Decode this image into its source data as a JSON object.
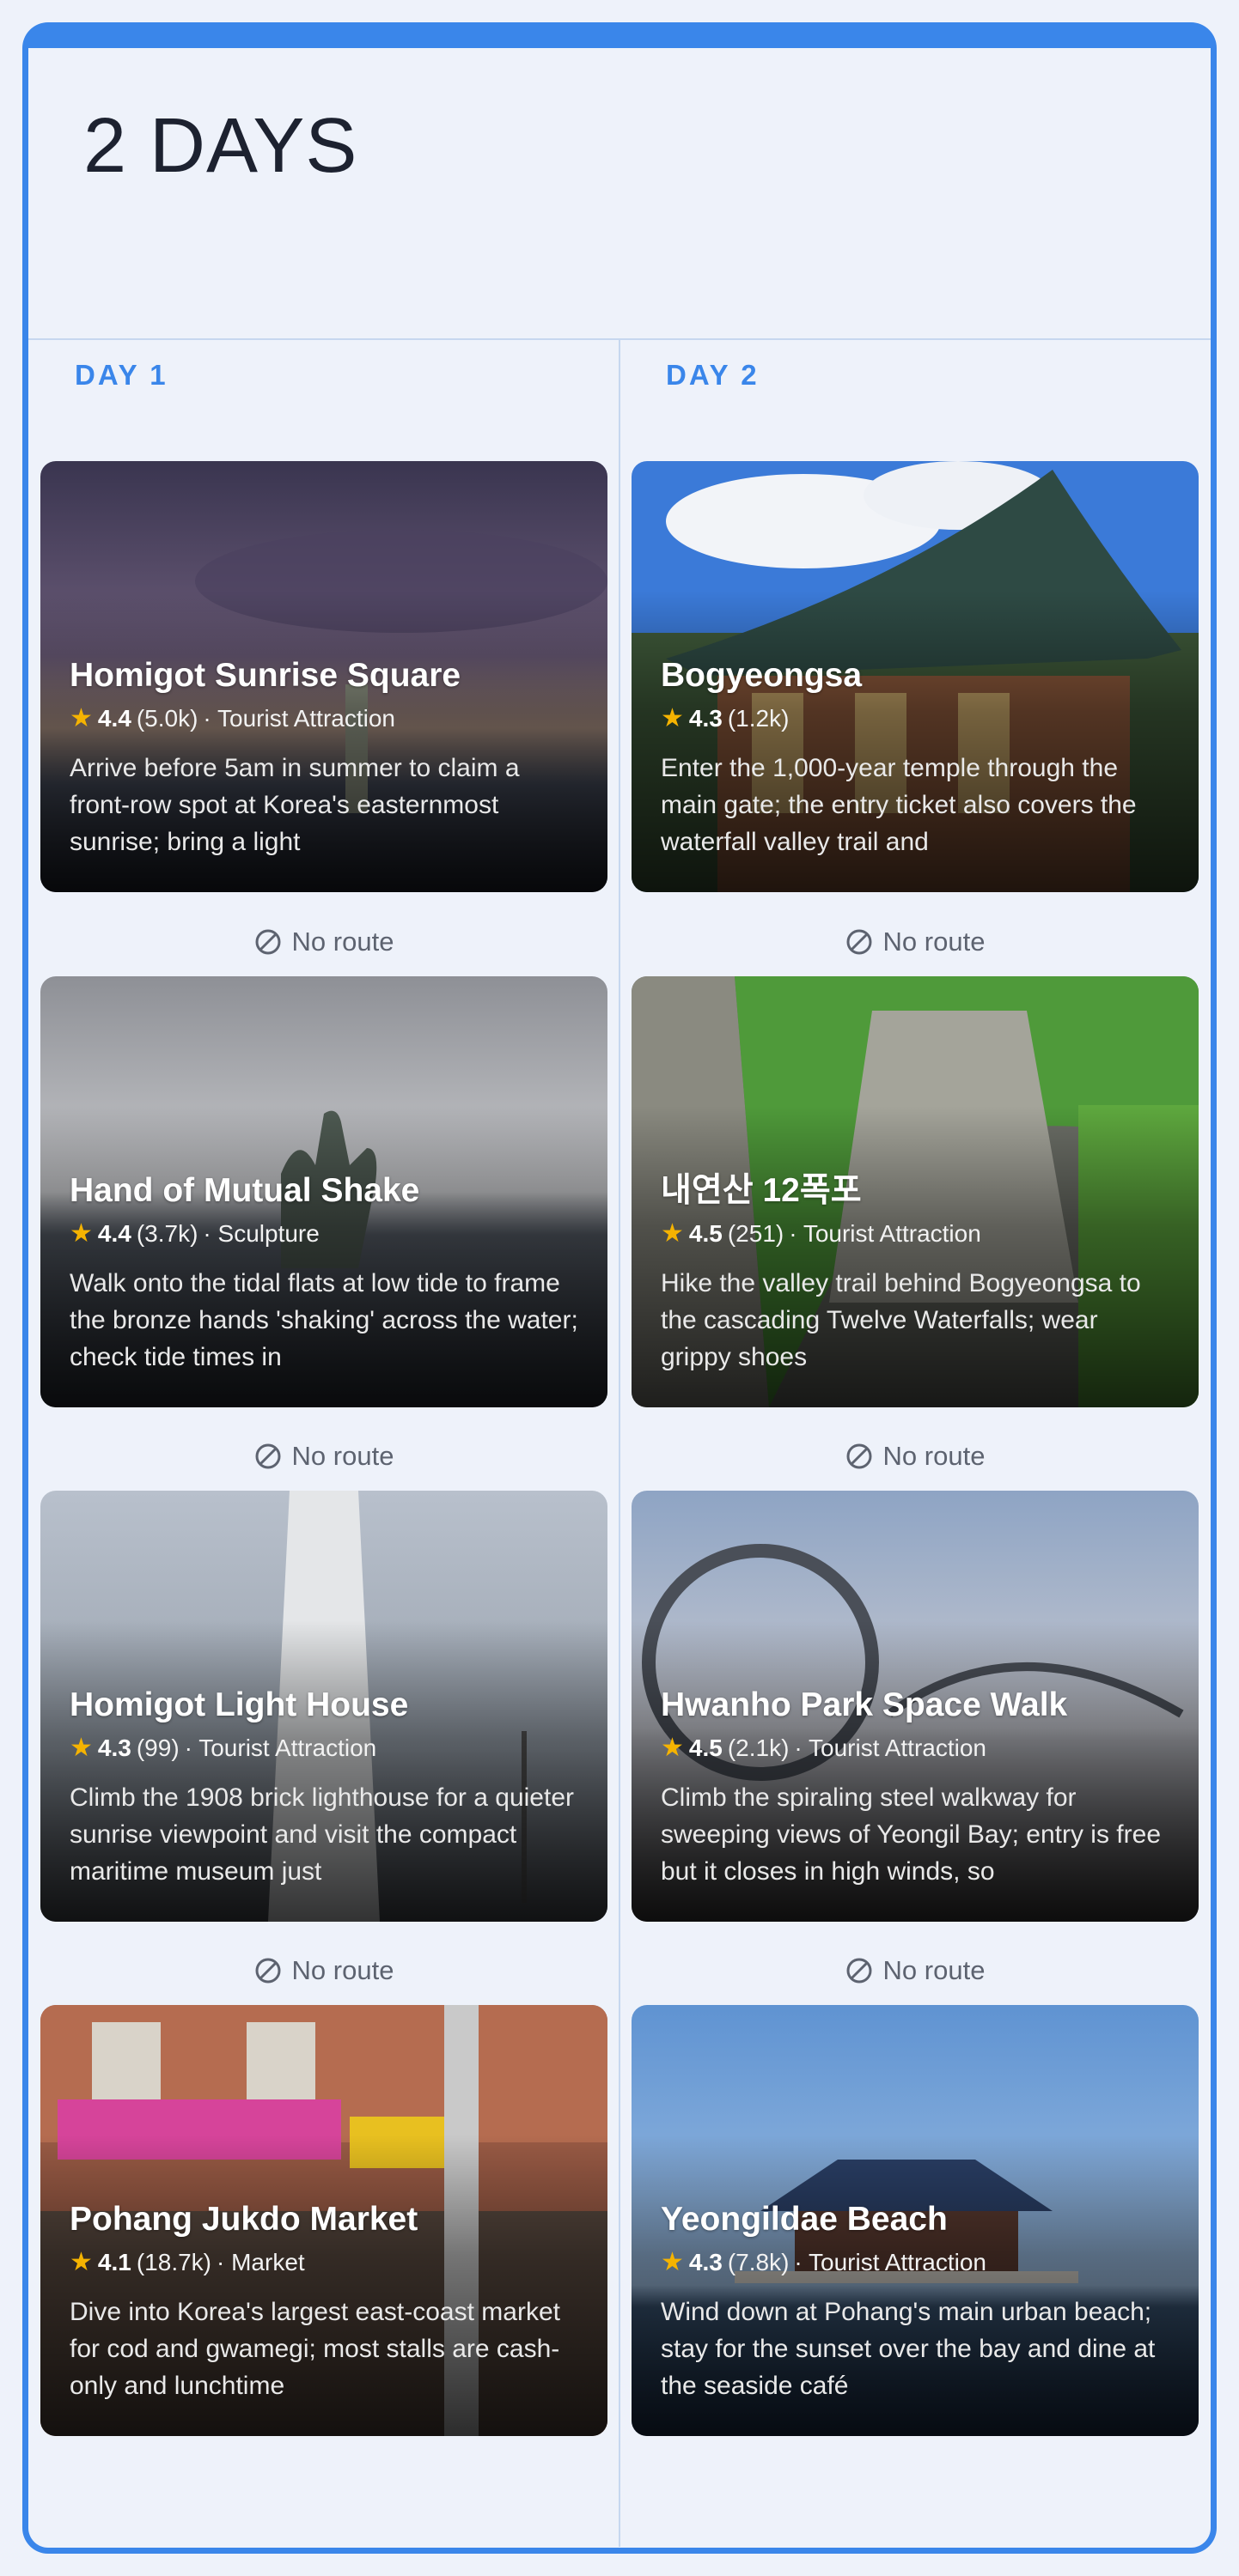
{
  "itinerary": {
    "title": "2 DAYS",
    "days": [
      {
        "label": "DAY 1"
      },
      {
        "label": "DAY 2"
      }
    ]
  },
  "cards": [
    {
      "name": "Homigot Sunrise Square",
      "rating": "4.4",
      "reviews": "(5.0k)",
      "category": "· Tourist Attraction",
      "description": "Arrive before 5am in summer to claim a front-row spot at Korea's easternmost sunrise; bring a light"
    },
    {
      "name": "Hand of Mutual Shake",
      "rating": "4.4",
      "reviews": "(3.7k)",
      "category": "· Sculpture",
      "description": "Walk onto the tidal flats at low tide to frame the bronze hands 'shaking' across the water; check tide times in"
    },
    {
      "name": "Homigot Light House",
      "rating": "4.3",
      "reviews": "(99)",
      "category": "· Tourist Attraction",
      "description": "Climb the 1908 brick lighthouse for a quieter sunrise viewpoint and visit the compact maritime museum just"
    },
    {
      "name": "Pohang Jukdo Market",
      "rating": "4.1",
      "reviews": "(18.7k)",
      "category": "· Market",
      "description": "Dive into Korea's largest east-coast market for cod and gwamegi; most stalls are cash-only and lunchtime"
    },
    {
      "name": "Bogyeongsa",
      "rating": "4.3",
      "reviews": "(1.2k)",
      "category": "",
      "description": "Enter the 1,000-year temple through the main gate; the entry ticket also covers the waterfall valley trail and"
    },
    {
      "name": "내연산 12폭포",
      "rating": "4.5",
      "reviews": "(251)",
      "category": "· Tourist Attraction",
      "description": "Hike the valley trail behind Bogyeongsa to the cascading Twelve Waterfalls; wear grippy shoes"
    },
    {
      "name": "Hwanho Park Space Walk",
      "rating": "4.5",
      "reviews": "(2.1k)",
      "category": "· Tourist Attraction",
      "description": "Climb the spiraling steel walkway for sweeping views of Yeongil Bay; entry is free but it closes in high winds, so"
    },
    {
      "name": "Yeongildae Beach",
      "rating": "4.3",
      "reviews": "(7.8k)",
      "category": "· Tourist Attraction",
      "description": "Wind down at Pohang's main urban beach; stay for the sunset over the bay and dine at the seaside café"
    }
  ],
  "routes": {
    "label": "No route"
  },
  "colors": {
    "accent": "#3a86ea",
    "star": "#f5b301",
    "background": "#eef2fa"
  },
  "icons": {
    "rating": "star-icon",
    "route": "no-route-icon"
  }
}
